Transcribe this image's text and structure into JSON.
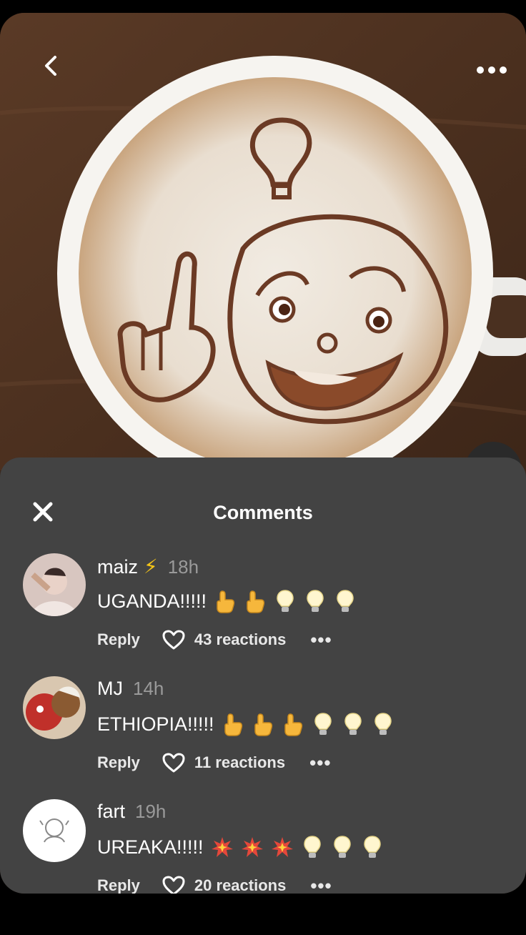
{
  "header": {
    "back_icon": "chevron-left-icon",
    "more_icon": "more-horizontal-icon"
  },
  "sheet": {
    "title": "Comments",
    "close_icon": "close-icon"
  },
  "comments": [
    {
      "username": "maiz",
      "badge": "⚡",
      "time": "18h",
      "text": "UGANDA!!!!!",
      "emojis": [
        "pointing-up",
        "pointing-up",
        "light-bulb",
        "light-bulb",
        "light-bulb"
      ],
      "reply_label": "Reply",
      "reactions": "43 reactions"
    },
    {
      "username": "MJ",
      "badge": "",
      "time": "14h",
      "text": "ETHIOPIA!!!!!",
      "emojis": [
        "pointing-up",
        "pointing-up",
        "pointing-up",
        "light-bulb",
        "light-bulb",
        "light-bulb"
      ],
      "reply_label": "Reply",
      "reactions": "11 reactions"
    },
    {
      "username": "fart",
      "badge": "",
      "time": "19h",
      "text": "UREAKA!!!!!",
      "emojis": [
        "collision",
        "collision",
        "collision",
        "light-bulb",
        "light-bulb",
        "light-bulb"
      ],
      "reply_label": "Reply",
      "reactions": "20 reactions"
    }
  ],
  "colors": {
    "sheet_bg": "#434343",
    "text": "#ffffff",
    "muted": "#9a9a9a"
  }
}
